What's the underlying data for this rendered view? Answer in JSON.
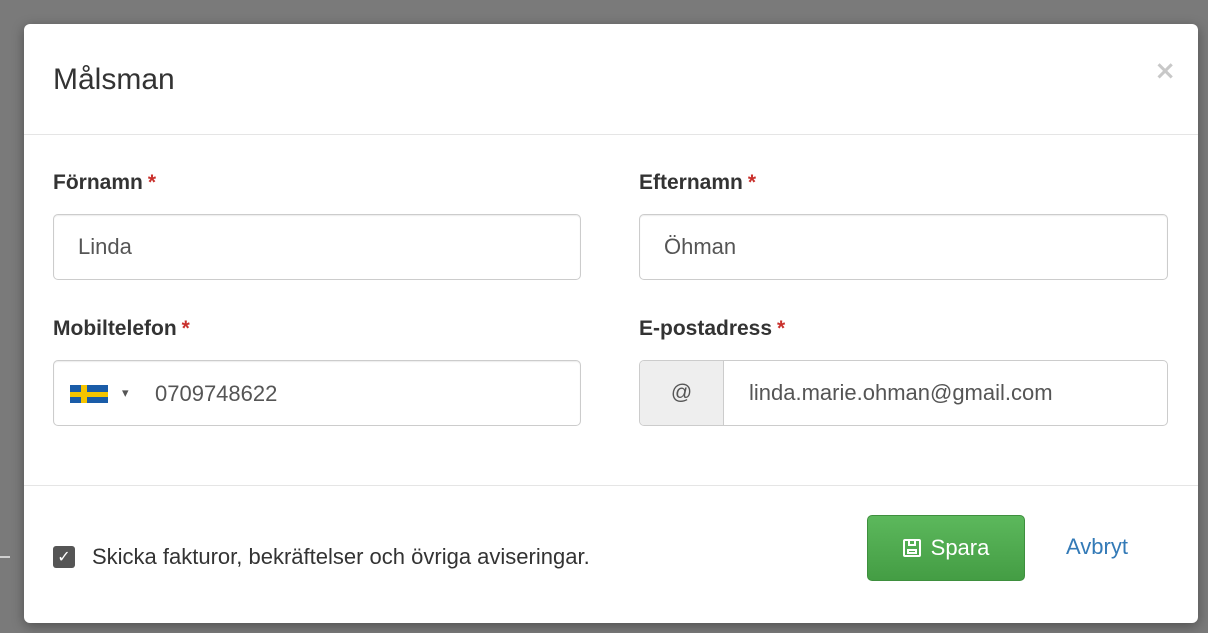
{
  "modal": {
    "title": "Målsman",
    "close_symbol": "×"
  },
  "form": {
    "required_marker": "*",
    "first_name": {
      "label": "Förnamn",
      "value": "Linda"
    },
    "last_name": {
      "label": "Efternamn",
      "value": "Öhman"
    },
    "mobile": {
      "label": "Mobiltelefon",
      "value": "0709748622",
      "country_flag": "sweden-flag-icon",
      "caret": "▾"
    },
    "email": {
      "label": "E-postadress",
      "addon": "@",
      "value": "linda.marie.ohman@gmail.com"
    }
  },
  "footer": {
    "notifications_checkbox": {
      "checked": true,
      "check_symbol": "✓",
      "label": "Skicka fakturor, bekräftelser och övriga aviseringar."
    },
    "save_label": "Spara",
    "cancel_label": "Avbryt"
  },
  "colors": {
    "save_button": "#5cb85c",
    "link": "#337ab7",
    "required": "#c9302c"
  }
}
